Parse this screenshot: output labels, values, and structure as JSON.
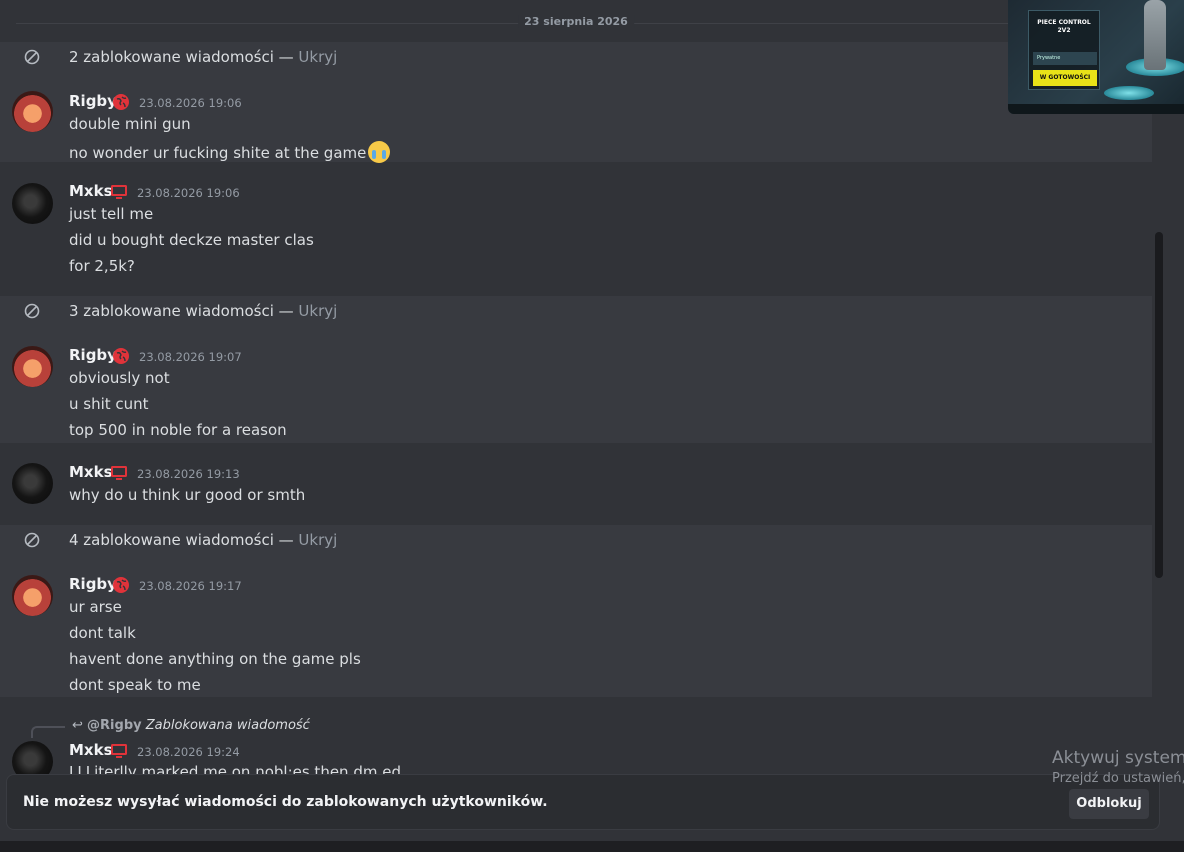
{
  "date_divider": "23 sierpnia 2026",
  "blocked_groups": [
    {
      "text": "2 zablokowane wiadomości — ",
      "hide": "Ukryj"
    },
    {
      "text": "3 zablokowane wiadomości — ",
      "hide": "Ukryj"
    },
    {
      "text": "4 zablokowane wiadomości — ",
      "hide": "Ukryj"
    }
  ],
  "messages": [
    {
      "author": "Rigby",
      "badge": "globe-icon",
      "timestamp": "23.08.2026 19:06",
      "lines": [
        "double mini gun",
        "no wonder ur fucking shite at the game"
      ],
      "emoji": "loudly-crying-emoji"
    },
    {
      "author": "Mxks",
      "badge": "monitor-icon",
      "timestamp": "23.08.2026 19:06",
      "lines": [
        "just tell me",
        "did u bought deckze master clas",
        "for 2,5k?"
      ]
    },
    {
      "author": "Rigby",
      "badge": "globe-icon",
      "timestamp": "23.08.2026 19:07",
      "lines": [
        "obviously not",
        "u shit cunt",
        "top 500 in noble for a reason"
      ]
    },
    {
      "author": "Mxks",
      "badge": "monitor-icon",
      "timestamp": "23.08.2026 19:13",
      "lines": [
        "why do u think ur good or smth"
      ]
    },
    {
      "author": "Rigby",
      "badge": "globe-icon",
      "timestamp": "23.08.2026 19:17",
      "lines": [
        "ur arse",
        "dont talk",
        "havent done anything on the game pls",
        "dont speak to me"
      ]
    },
    {
      "author": "Mxks",
      "badge": "monitor-icon",
      "timestamp": "23.08.2026 19:24",
      "reply": {
        "mention": "@Rigby",
        "text": "Zablokowana wiadomość"
      },
      "lines": [
        "LLLiterlly marked me on nobl;es then dm ed"
      ]
    }
  ],
  "game_overlay": {
    "mode_title": "PIECE CONTROL\n2V2",
    "private_label": "Prywatne",
    "ready_button": "W GOTOWOŚCI"
  },
  "composer": {
    "notice": "Nie możesz wysyłać wiadomości do zablokowanych użytkowników.",
    "unblock_button": "Odblokuj"
  },
  "windows_activation": {
    "title": "Aktywuj system Windows",
    "subtitle": "Przejdź do ustawień, aby aktywować system Windows."
  },
  "colors": {
    "background": "#313338",
    "alt_background": "#383a40",
    "composer": "#2b2d31",
    "badge_red": "#e0333a",
    "ready_yellow": "#e8e218"
  }
}
